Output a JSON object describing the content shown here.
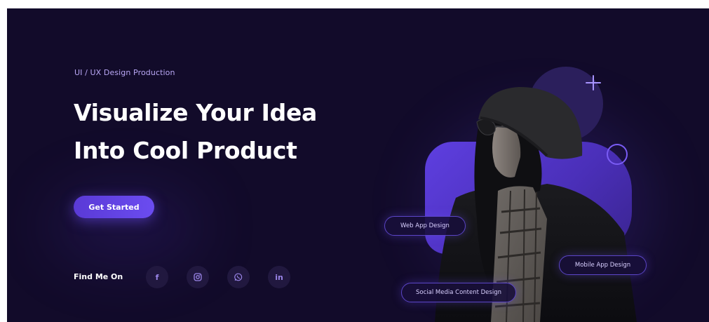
{
  "hero": {
    "eyebrow": "UI / UX Design Production",
    "headline_line1": "Visualize Your Idea",
    "headline_line2": "Into Cool Product",
    "cta_label": "Get Started",
    "find_me_label": "Find Me On",
    "socials": [
      {
        "icon": "facebook-icon",
        "glyph": "f"
      },
      {
        "icon": "instagram-icon",
        "glyph": ""
      },
      {
        "icon": "whatsapp-icon",
        "glyph": ""
      },
      {
        "icon": "linkedin-icon",
        "glyph": "in"
      }
    ]
  },
  "tags": {
    "web_app": "Web App Design",
    "mobile_app": "Mobile App Design",
    "social_media": "Social Media Content Design"
  },
  "colors": {
    "background": "#120b2a",
    "accent": "#6b4cf0",
    "eyebrow_text": "#b9a7f5"
  }
}
